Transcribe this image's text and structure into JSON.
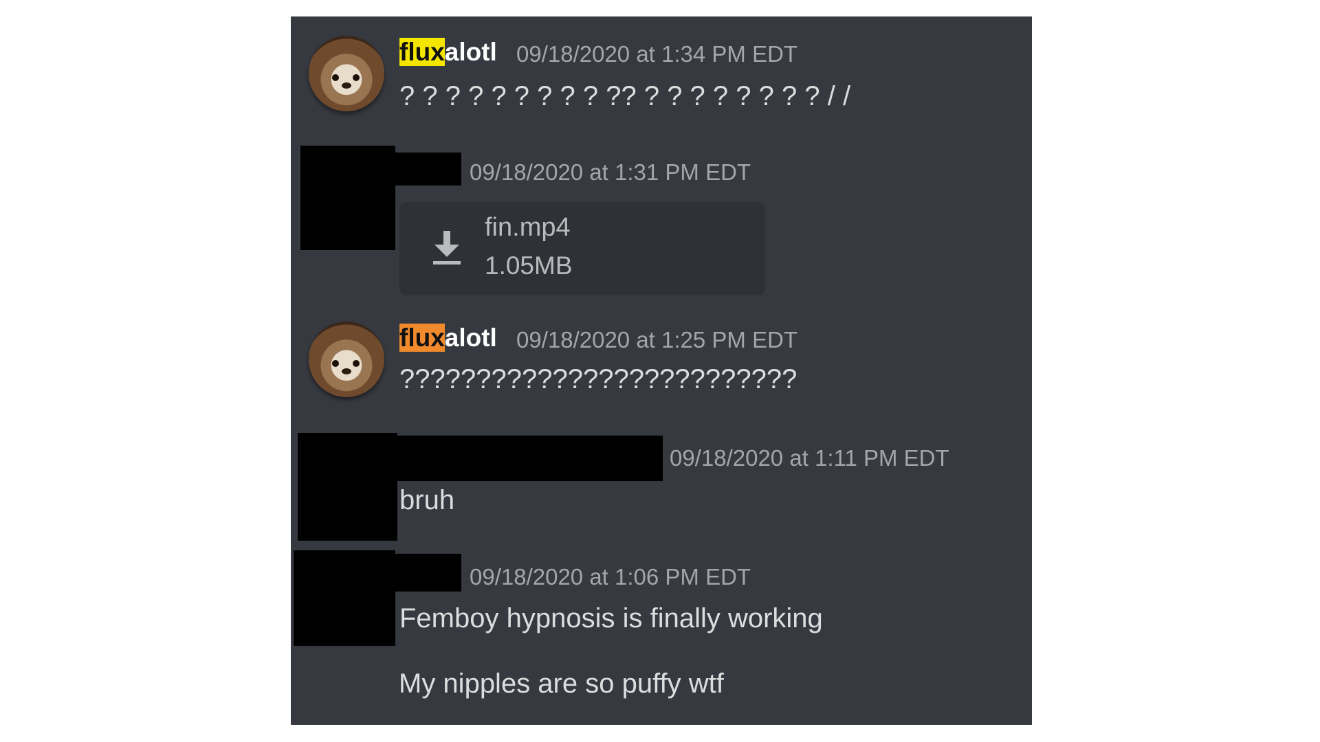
{
  "messages": [
    {
      "username_highlight": "flux",
      "username_rest": "alotl",
      "timestamp": "09/18/2020 at 1:34 PM EDT",
      "text": "? ? ? ? ? ? ? ? ? ?? ? ? ? ? ? ? ? ? / /"
    },
    {
      "timestamp": "09/18/2020 at 1:31 PM EDT",
      "attachment": {
        "filename": "fin.mp4",
        "size": "1.05MB",
        "icon": "download-icon"
      }
    },
    {
      "username_highlight": "flux",
      "username_rest": "alotl",
      "timestamp": "09/18/2020 at 1:25 PM EDT",
      "text": "??????????????????????????"
    },
    {
      "timestamp": "09/18/2020 at 1:11 PM EDT",
      "text": "bruh"
    },
    {
      "timestamp": "09/18/2020 at 1:06 PM EDT",
      "lines": [
        "Femboy hypnosis is finally working",
        "My nipples are so puffy wtf"
      ]
    }
  ],
  "colors": {
    "background": "#36393f",
    "attachment_bg": "#2f3136",
    "highlight_yellow": "#f5e600",
    "highlight_orange": "#f08a2c",
    "timestamp": "#a3a6aa",
    "text": "#dcddde"
  }
}
